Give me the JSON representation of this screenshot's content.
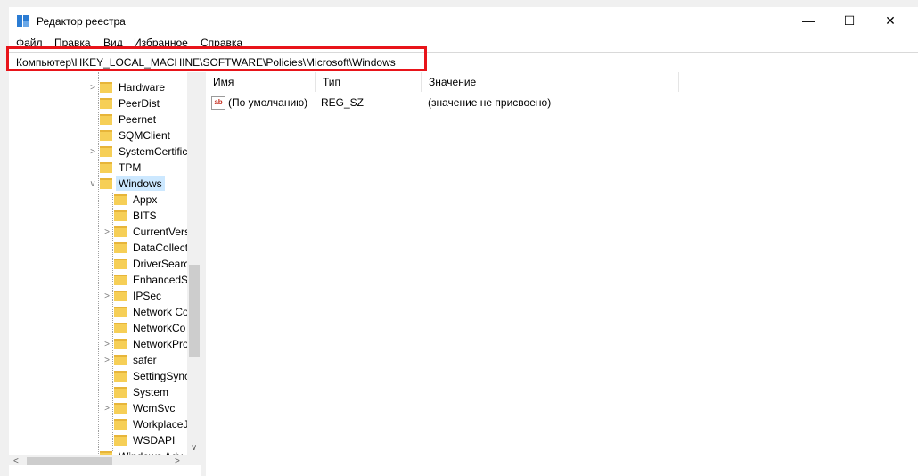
{
  "window": {
    "title": "Редактор реестра",
    "min": "—",
    "max": "☐",
    "close": "✕"
  },
  "menu": {
    "file": "Файл",
    "edit": "Правка",
    "view": "Вид",
    "favorites": "Избранное",
    "help": "Справка"
  },
  "address": {
    "path": "Компьютер\\HKEY_LOCAL_MACHINE\\SOFTWARE\\Policies\\Microsoft\\Windows"
  },
  "tree": {
    "items": [
      {
        "label": "Hardware"
      },
      {
        "label": "PeerDist"
      },
      {
        "label": "Peernet"
      },
      {
        "label": "SQMClient"
      },
      {
        "label": "SystemCertific"
      },
      {
        "label": "TPM"
      },
      {
        "label": "Windows"
      },
      {
        "label": "Appx"
      },
      {
        "label": "BITS"
      },
      {
        "label": "CurrentVers"
      },
      {
        "label": "DataCollect"
      },
      {
        "label": "DriverSearc"
      },
      {
        "label": "EnhancedS"
      },
      {
        "label": "IPSec"
      },
      {
        "label": "Network Co"
      },
      {
        "label": "NetworkCo"
      },
      {
        "label": "NetworkPro"
      },
      {
        "label": "safer"
      },
      {
        "label": "SettingSync"
      },
      {
        "label": "System"
      },
      {
        "label": "WcmSvc"
      },
      {
        "label": "WorkplaceJ"
      },
      {
        "label": "WSDAPI"
      },
      {
        "label": "Windows Adv"
      }
    ]
  },
  "list": {
    "columns": {
      "name": "Имя",
      "type": "Тип",
      "value": "Значение"
    },
    "rows": [
      {
        "name": "(По умолчанию)",
        "type": "REG_SZ",
        "value": "(значение не присвоено)"
      }
    ]
  },
  "icons": {
    "reg_string": "ab"
  },
  "colors": {
    "highlight": "#e8141a",
    "selection": "#cce8ff",
    "folder": "#f6cf57"
  }
}
